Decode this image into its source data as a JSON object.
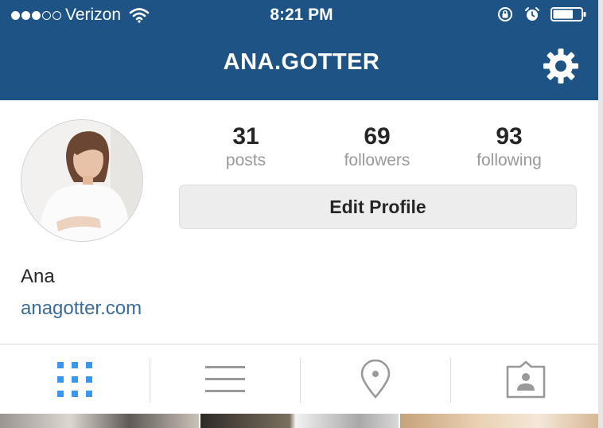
{
  "status_bar": {
    "carrier": "Verizon",
    "time": "8:21 PM",
    "signal_filled": 3,
    "signal_total": 5,
    "battery_level": 0.7
  },
  "header": {
    "title": "ANA.GOTTER",
    "background": "#1d5385",
    "settings_icon": "gear-icon"
  },
  "profile": {
    "stats": [
      {
        "value": "31",
        "label": "posts"
      },
      {
        "value": "69",
        "label": "followers"
      },
      {
        "value": "93",
        "label": "following"
      }
    ],
    "edit_button_label": "Edit Profile",
    "name": "Ana",
    "website": "anagotter.com",
    "link_color": "#3a6b9a"
  },
  "tabs": [
    {
      "icon": "grid-icon",
      "active": true
    },
    {
      "icon": "list-icon",
      "active": false
    },
    {
      "icon": "location-pin-icon",
      "active": false
    },
    {
      "icon": "tagged-photos-icon",
      "active": false
    }
  ],
  "colors": {
    "active_tab": "#3897f0",
    "inactive_tab": "#999999"
  }
}
